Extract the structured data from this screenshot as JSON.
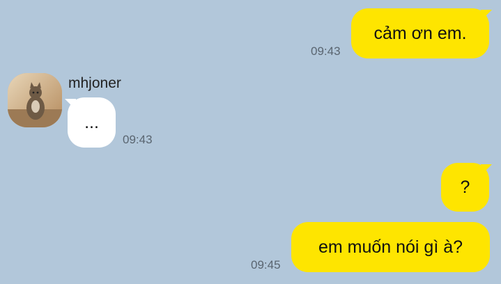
{
  "messages": [
    {
      "text": "cảm ơn em.",
      "time": "09:43",
      "from": "me"
    },
    {
      "sender": "mhjoner",
      "text": "...",
      "time": "09:43",
      "from": "them"
    },
    {
      "text": "?",
      "time": "",
      "from": "me"
    },
    {
      "text": "em muốn nói gì à?",
      "time": "09:45",
      "from": "me"
    }
  ],
  "colors": {
    "background": "#b2c7da",
    "my_bubble": "#fee500",
    "their_bubble": "#ffffff"
  }
}
